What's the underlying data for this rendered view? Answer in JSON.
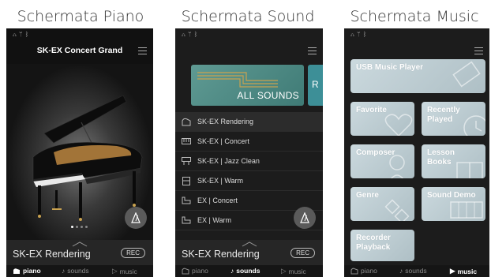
{
  "captions": {
    "piano": "Schermata Piano",
    "sound": "Schermata Sound",
    "music": "Schermata Music"
  },
  "piano_screen": {
    "title": "SK-EX Concert Grand",
    "current_sound": "SK-EX Rendering",
    "rec_label": "REC"
  },
  "sound_screen": {
    "banner_label": "ALL SOUNDS",
    "banner_next_initial": "R",
    "items": [
      {
        "label": "SK-EX Rendering",
        "icon": "grand-piano-icon"
      },
      {
        "label": "SK-EX | Concert",
        "icon": "keyboard-icon"
      },
      {
        "label": "SK-EX | Jazz Clean",
        "icon": "keyboard-stand-icon"
      },
      {
        "label": "SK-EX | Warm",
        "icon": "upright-piano-icon"
      },
      {
        "label": "EX | Concert",
        "icon": "piano-outline-icon"
      },
      {
        "label": "EX | Warm",
        "icon": "piano-outline-icon"
      }
    ],
    "current_sound": "SK-EX Rendering",
    "rec_label": "REC"
  },
  "music_screen": {
    "tiles": {
      "usb": "USB Music Player",
      "favorite": "Favorite",
      "recently_played": "Recently Played",
      "composer": "Composer",
      "lesson_books": "Lesson Books",
      "genre": "Genre",
      "sound_demo": "Sound Demo",
      "recorder_playback": "Recorder Playback"
    }
  },
  "tabs": {
    "piano": "piano",
    "sounds": "sounds",
    "music": "music"
  },
  "colors": {
    "phone_bg": "#1c1c1c",
    "tile_blue": "#b9cbd1",
    "banner_teal": "#4f8a85"
  }
}
